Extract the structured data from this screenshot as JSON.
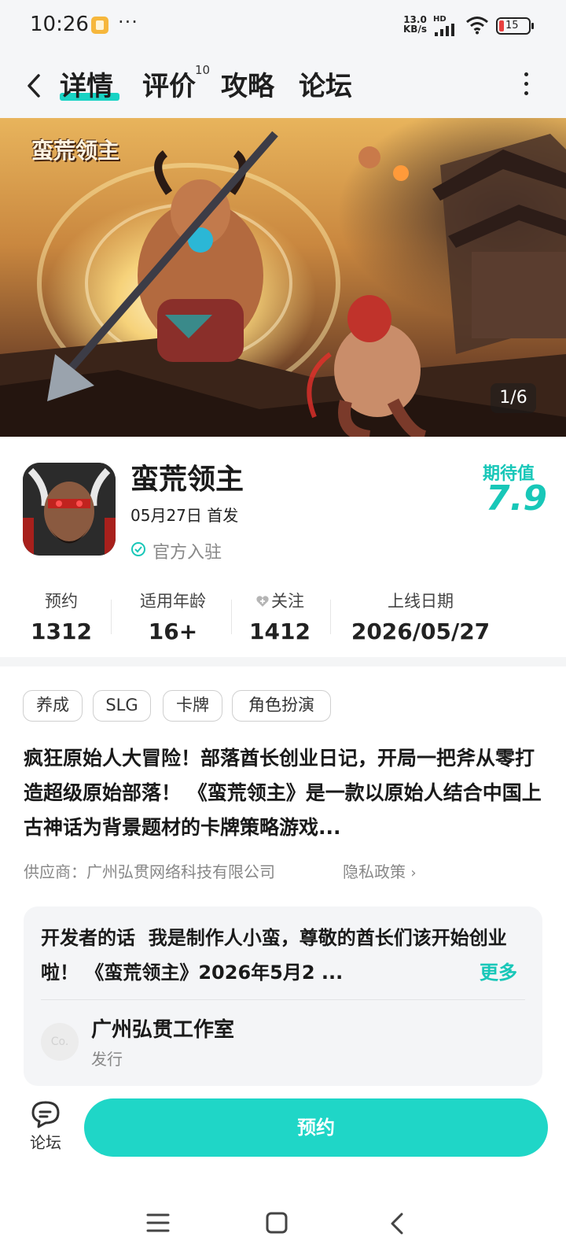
{
  "status_bar": {
    "time": "10:26",
    "dots": "···",
    "speed_value": "13.0",
    "speed_unit": "KB/s",
    "network_label": "HD",
    "battery": "15"
  },
  "header": {
    "tabs": [
      {
        "label": "详情",
        "active": true
      },
      {
        "label": "评价",
        "badge": "10"
      },
      {
        "label": "攻略"
      },
      {
        "label": "论坛"
      }
    ]
  },
  "banner": {
    "logo_text": "蛮荒领主",
    "counter": "1/6"
  },
  "game": {
    "title": "蛮荒领主",
    "release": "05月27日 首发",
    "official": "官方入驻",
    "score_label": "期待值",
    "score": "7.9"
  },
  "stats": [
    {
      "label": "预约",
      "value": "1312"
    },
    {
      "label": "适用年龄",
      "value": "16+"
    },
    {
      "label": "关注",
      "value": "1412"
    },
    {
      "label": "上线日期",
      "value": "2026/05/27"
    }
  ],
  "tags": [
    "养成",
    "SLG",
    "卡牌",
    "角色扮演"
  ],
  "description": "疯狂原始人大冒险！部落酋长创业日记，开局一把斧从零打造超级原始部落！ 《蛮荒领主》是一款以原始人结合中国上古神话为背景题材的卡牌策略游戏...",
  "provider": "供应商：广州弘贯网络科技有限公司",
  "privacy": "隐私政策",
  "developer": {
    "title": "开发者的话",
    "text": "我是制作人小蛮，尊敬的酋长们该开始创业啦！ 《蛮荒领主》2026年5月2 ...",
    "more": "更多",
    "studio_avatar": "Co.",
    "studio_name": "广州弘贯工作室",
    "studio_role": "发行"
  },
  "bottom": {
    "forum_label": "论坛",
    "reserve_label": "预约"
  },
  "colors": {
    "accent": "#1fd6c7",
    "score": "#18c7b8"
  }
}
